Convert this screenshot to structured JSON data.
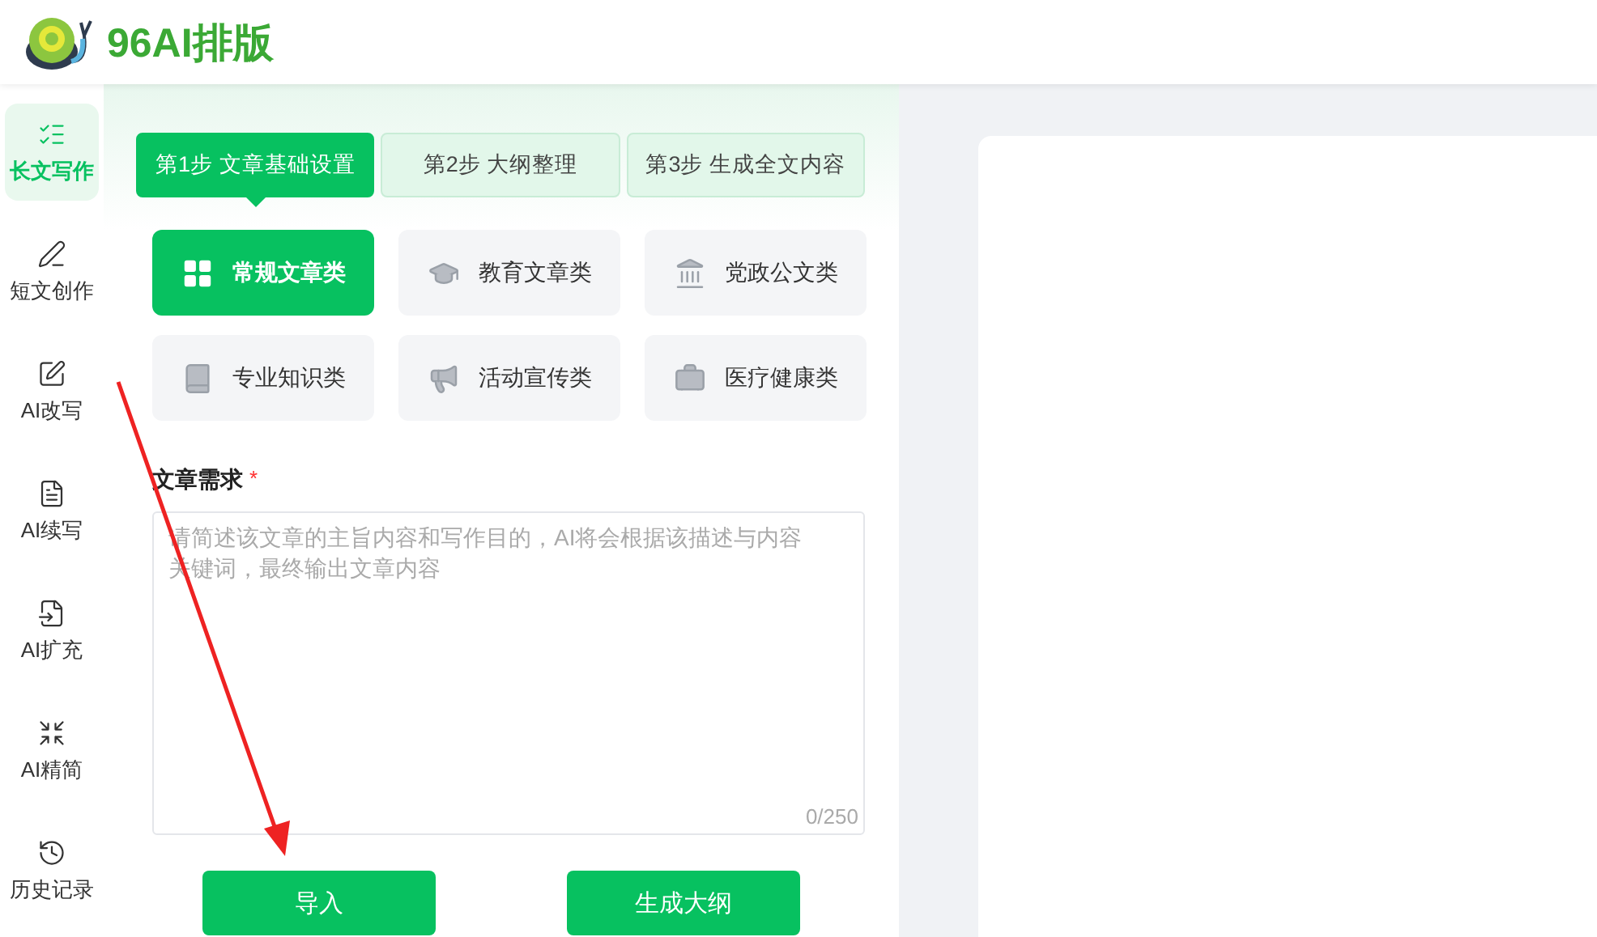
{
  "header": {
    "logo_text": "96AI排版"
  },
  "sidebar": {
    "items": [
      {
        "label": "长文写作",
        "selected": true
      },
      {
        "label": "短文创作",
        "selected": false
      },
      {
        "label": "AI改写",
        "selected": false
      },
      {
        "label": "AI续写",
        "selected": false
      },
      {
        "label": "AI扩充",
        "selected": false
      },
      {
        "label": "AI精简",
        "selected": false
      },
      {
        "label": "历史记录",
        "selected": false
      }
    ]
  },
  "steps": [
    {
      "label": "第1步 文章基础设置",
      "selected": true
    },
    {
      "label": "第2步 大纲整理",
      "selected": false
    },
    {
      "label": "第3步 生成全文内容",
      "selected": false
    }
  ],
  "categories": [
    {
      "label": "常规文章类",
      "selected": true
    },
    {
      "label": "教育文章类",
      "selected": false
    },
    {
      "label": "党政公文类",
      "selected": false
    },
    {
      "label": "专业知识类",
      "selected": false
    },
    {
      "label": "活动宣传类",
      "selected": false
    },
    {
      "label": "医疗健康类",
      "selected": false
    }
  ],
  "requirement": {
    "label": "文章需求",
    "required_mark": "*",
    "placeholder": "请简述该文章的主旨内容和写作目的，AI将会根据该描述与内容关键词，最终输出文章内容",
    "counter": "0/250"
  },
  "buttons": [
    "导入",
    "生成大纲"
  ]
}
